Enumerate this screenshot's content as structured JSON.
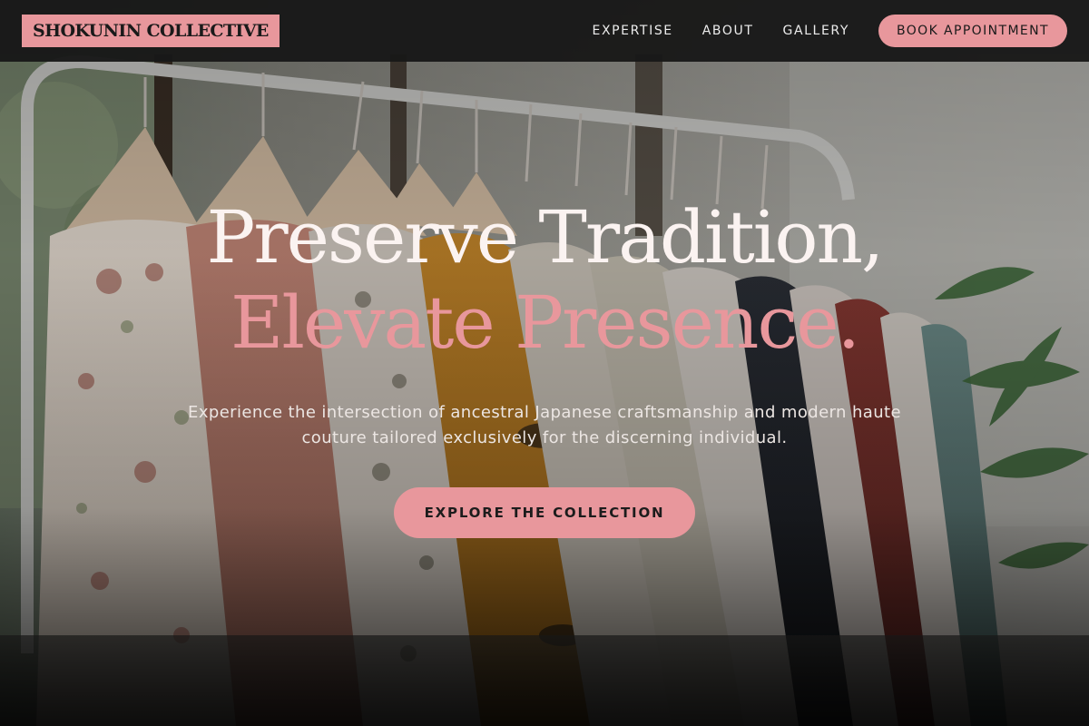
{
  "brand": {
    "name": "SHOKUNIN COLLECTIVE"
  },
  "nav": {
    "links": [
      "EXPERTISE",
      "ABOUT",
      "GALLERY"
    ],
    "book_label": "BOOK APPOINTMENT"
  },
  "hero": {
    "headline_line1": "Preserve Tradition,",
    "headline_line2": "Elevate Presence.",
    "subtext": "Experience the intersection of ancestral Japanese craftsmanship and modern haute couture tailored exclusively for the discerning individual.",
    "cta_label": "EXPLORE THE COLLECTION",
    "background_image": "garment-rack-photo"
  },
  "colors": {
    "accent": "#e8979c",
    "nav_bg": "#181818",
    "headline_light": "#fbf3f1"
  }
}
